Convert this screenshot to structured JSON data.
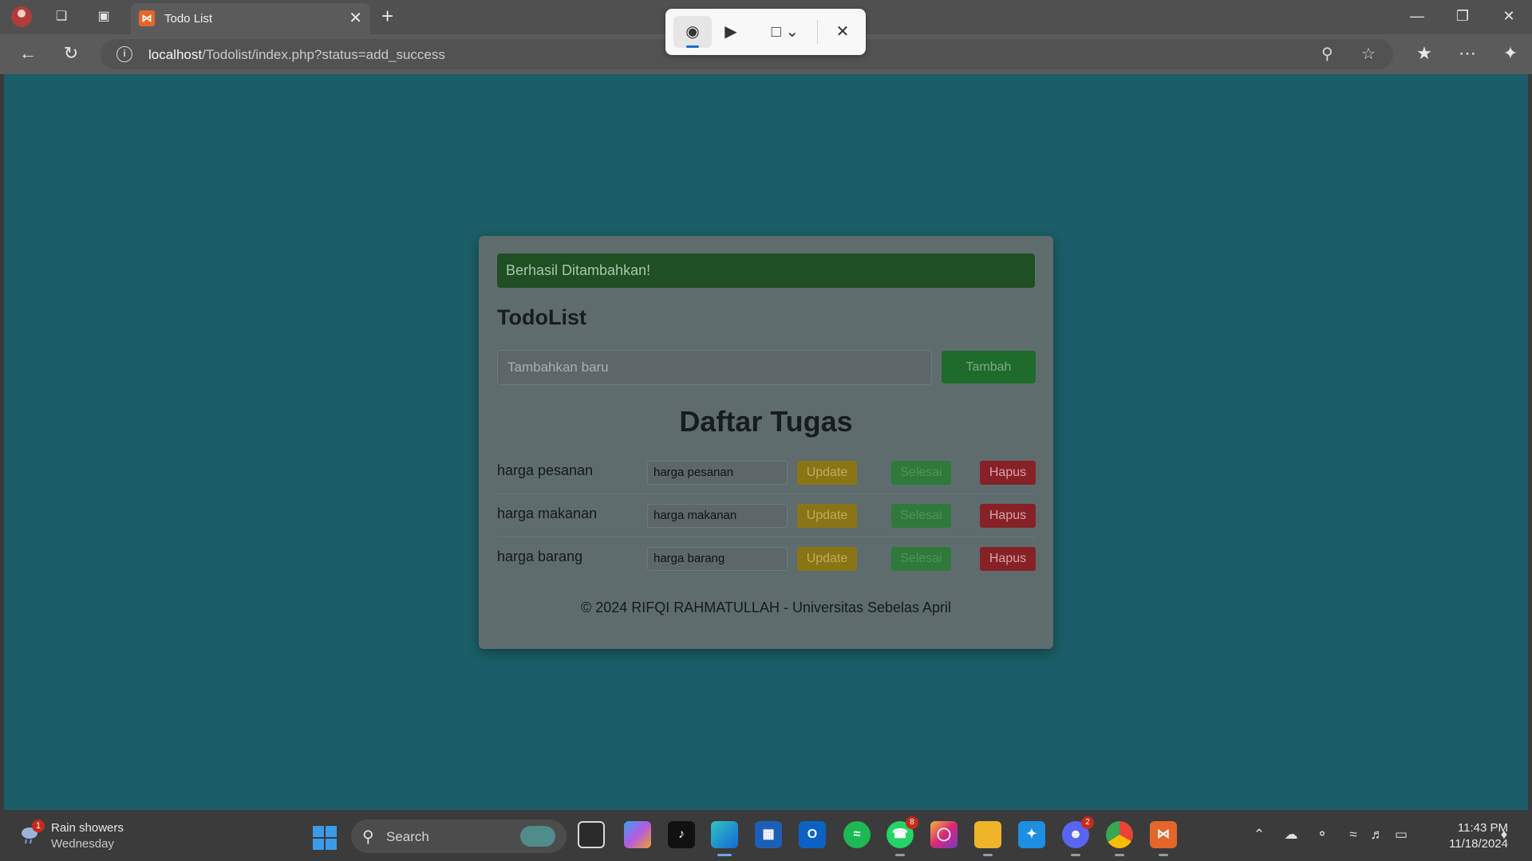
{
  "browser": {
    "tab_title": "Todo List",
    "url_host": "localhost",
    "url_path": "/Todolist/index.php?status=add_success"
  },
  "page": {
    "alert": "Berhasil Ditambahkan!",
    "title": "TodoList",
    "new_task_placeholder": "Tambahkan baru",
    "add_button": "Tambah",
    "list_heading": "Daftar Tugas",
    "tasks": [
      {
        "label": "harga pesanan",
        "value": "harga pesanan",
        "update": "Update",
        "done": "Selesai",
        "delete": "Hapus"
      },
      {
        "label": "harga makanan",
        "value": "harga makanan",
        "update": "Update",
        "done": "Selesai",
        "delete": "Hapus"
      },
      {
        "label": "harga barang",
        "value": "harga barang",
        "update": "Update",
        "done": "Selesai",
        "delete": "Hapus"
      }
    ],
    "footer": "© 2024 RIFQI RAHMATULLAH - Universitas Sebelas April"
  },
  "taskbar": {
    "weather_title": "Rain showers",
    "weather_sub": "Wednesday",
    "weather_badge": "1",
    "search_label": "Search",
    "whatsapp_badge": "8",
    "discord_badge": "2",
    "time": "11:43 PM",
    "date": "11/18/2024"
  },
  "colors": {
    "page_bg": "#1a5e67",
    "card_bg": "#5f6c6e",
    "alert_bg": "#1f4f23",
    "update_bg": "#8a7516",
    "done_bg": "#2f7a3b",
    "delete_bg": "#872128"
  }
}
